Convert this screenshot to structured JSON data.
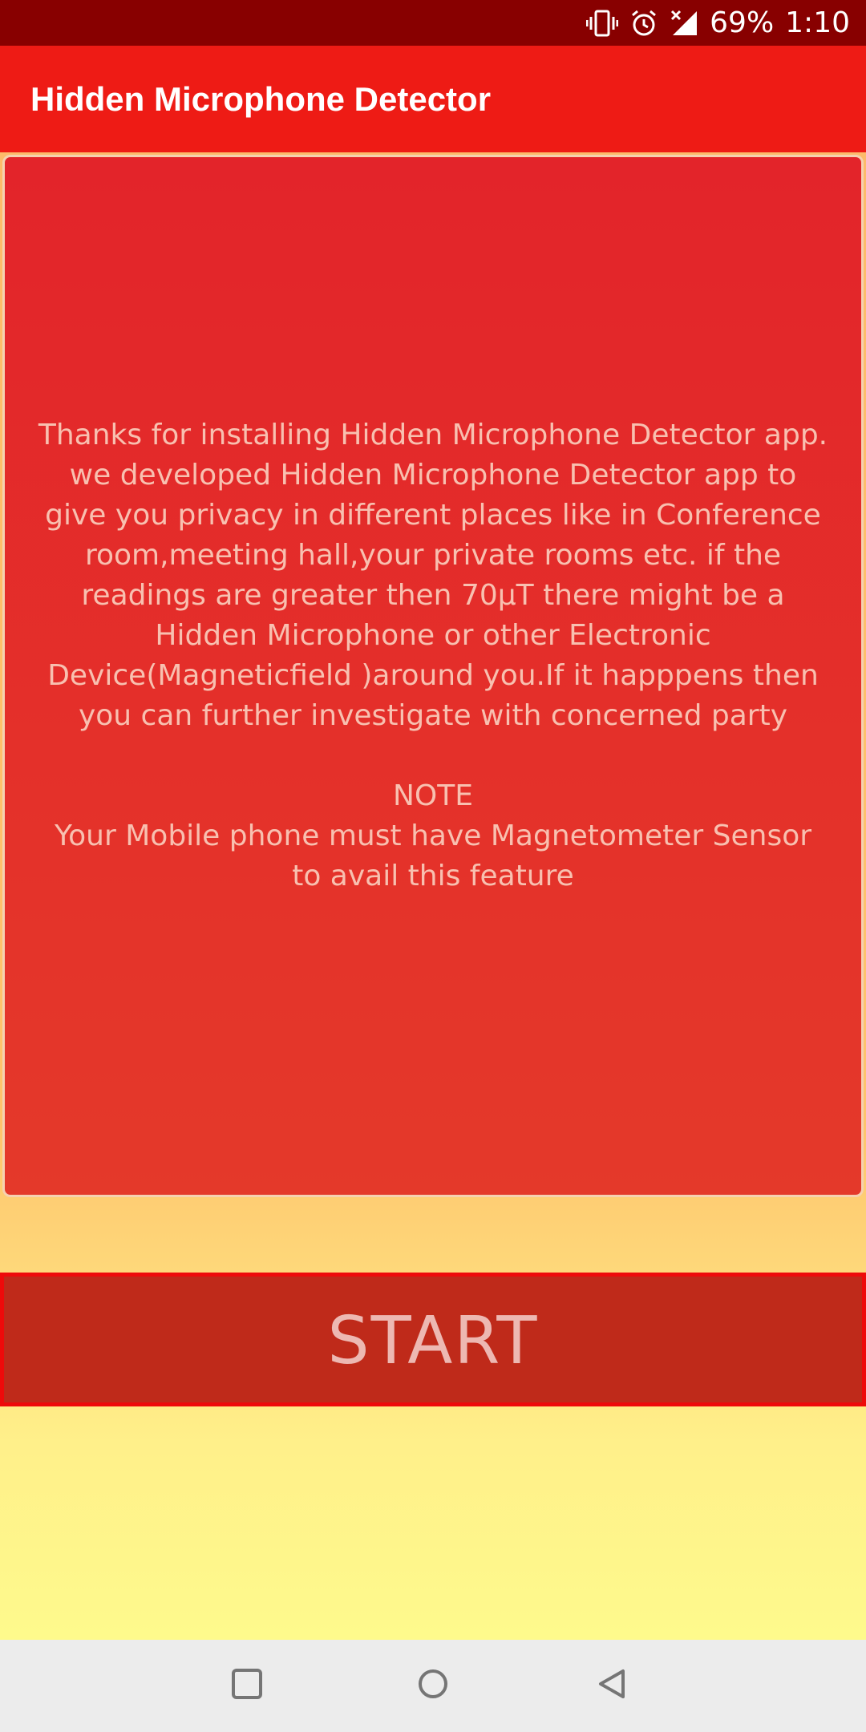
{
  "status_bar": {
    "battery_percent": "69%",
    "time": "1:10",
    "icons": [
      "vibrate-icon",
      "alarm-icon",
      "signal-no-data-icon"
    ]
  },
  "app_bar": {
    "title": "Hidden Microphone Detector"
  },
  "info_card": {
    "paragraph": "Thanks for installing Hidden Microphone Detector app. we developed Hidden Microphone Detector app to give you privacy in different places like in Conference room,meeting hall,your private rooms etc. if the readings are greater then 70µT there might be a Hidden Microphone or other Electronic Device(Magneticfield )around you.If it happpens then you can further investigate with concerned party",
    "note_heading": "NOTE",
    "note_text": "Your Mobile phone must have Magnetometer Sensor to avail this feature"
  },
  "start_button": {
    "label": "START"
  },
  "nav_bar": {
    "icons": [
      "recents-icon",
      "home-icon",
      "back-icon"
    ]
  },
  "colors": {
    "status_bar": "#880000",
    "app_bar": "#ee1b15",
    "card_fill": "#e3242a",
    "card_border": "#f6d1b0",
    "card_text": "#f8c0b0",
    "button_fill": "#bf2a1a",
    "button_border": "#ee0a0a",
    "button_text": "#edb8b2",
    "background_top": "#fdb96a",
    "background_bottom": "#fefa8c",
    "nav_bar": "#ececec"
  }
}
